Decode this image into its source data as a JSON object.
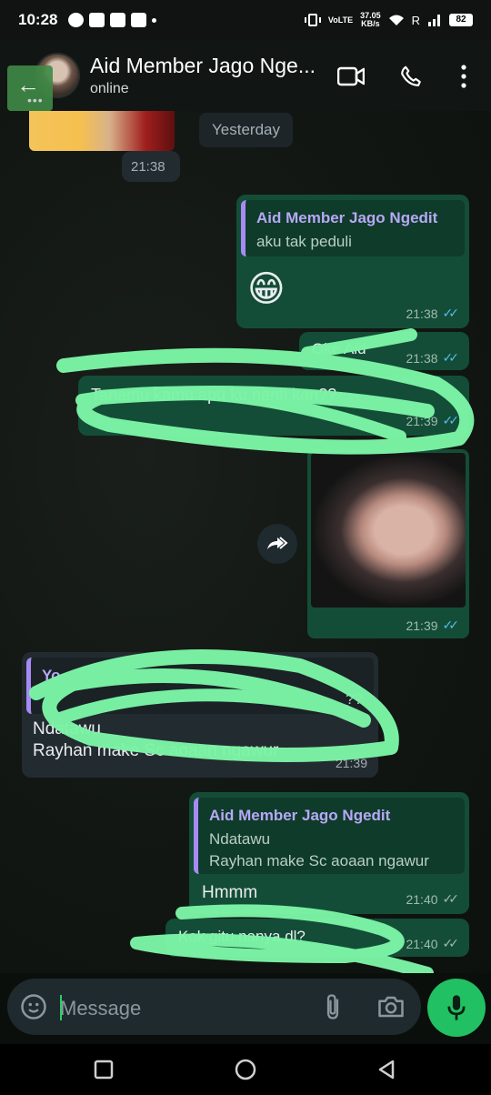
{
  "status_bar": {
    "time": "10:28",
    "network": "VoLTE",
    "speed": "37.05",
    "speed_unit": "KB/s",
    "roaming": "R",
    "battery": "82"
  },
  "header": {
    "title": "Aid Member Jago Ngedit",
    "title_display": "Aid Member Jago Nge...",
    "status": "online"
  },
  "chat": {
    "date_separator": "Yesterday",
    "messages": [
      {
        "id": "m1",
        "direction": "incoming",
        "kind": "image",
        "time": "21:38"
      },
      {
        "id": "m2",
        "direction": "outgoing",
        "reply_to": {
          "author": "Aid Member Jago Ngedit",
          "text": "aku tak peduli"
        },
        "text": "😁",
        "time": "21:38",
        "status": "read"
      },
      {
        "id": "m3",
        "direction": "outgoing",
        "text": "Oke Aid",
        "time": "21:38",
        "status": "read",
        "redacted": true
      },
      {
        "id": "m4",
        "direction": "outgoing",
        "text": "Tanamu kamu apu ku nanti kan??",
        "time": "21:39",
        "status": "read",
        "redacted": true
      },
      {
        "id": "m5",
        "direction": "outgoing",
        "kind": "image",
        "time": "21:39",
        "status": "read"
      },
      {
        "id": "m6",
        "direction": "incoming",
        "reply_to": {
          "author": "Yo",
          "text": "??"
        },
        "text_line1": "Ndatawu",
        "text_line2": "Rayhan make Sc aoaan ngawur",
        "time": "21:39",
        "redacted": true
      },
      {
        "id": "m7",
        "direction": "outgoing",
        "reply_to": {
          "author": "Aid Member Jago Ngedit",
          "text_line1": "Ndatawu",
          "text_line2": "Rayhan make Sc aoaan ngawur"
        },
        "text": "Hmmm",
        "time": "21:40",
        "status": "delivered"
      },
      {
        "id": "m8",
        "direction": "outgoing",
        "text": "Kok gitu nanya dl?",
        "time": "21:40",
        "status": "delivered",
        "redacted": true
      }
    ]
  },
  "input": {
    "placeholder": "Message"
  },
  "colors": {
    "outgoing_bubble": "#144d37",
    "incoming_bubble": "#222b30",
    "accent": "#21c063",
    "read_tick": "#53bdeb",
    "scribble": "#7cf5a6"
  },
  "icons": {
    "back": "arrow-left-icon",
    "video": "video-call-icon",
    "call": "phone-icon",
    "menu": "more-vertical-icon",
    "forward": "forward-icon",
    "sticker": "sticker-icon",
    "attach": "paperclip-icon",
    "camera": "camera-icon",
    "mic": "microphone-icon"
  }
}
